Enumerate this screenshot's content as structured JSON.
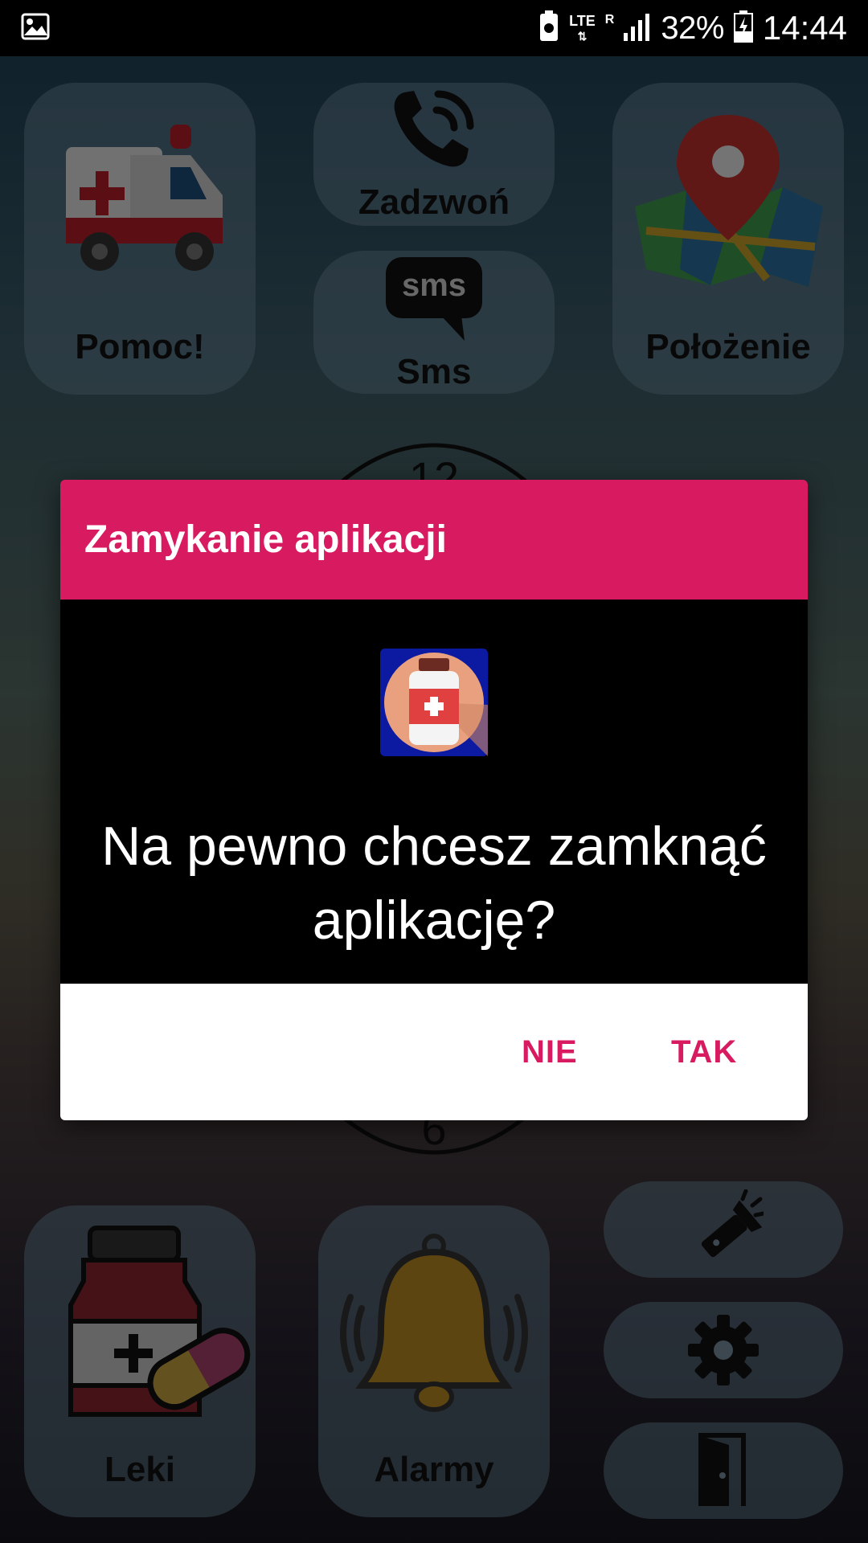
{
  "status_bar": {
    "network": "LTE",
    "roaming": "R",
    "battery": "32%",
    "time": "14:44"
  },
  "tiles": {
    "help": "Pomoc!",
    "call": "Zadzwoń",
    "sms": "Sms",
    "location": "Położenie",
    "meds": "Leki",
    "alarms": "Alarmy"
  },
  "clock": {
    "top": "12",
    "bottom": "6"
  },
  "dialog": {
    "title": "Zamykanie aplikacji",
    "message": "Na pewno chcesz zamknąć aplikację?",
    "no_label": "NIE",
    "yes_label": "TAK"
  },
  "colors": {
    "accent": "#d81b60",
    "tile": "#6e8ca0",
    "dialog_body": "#000000"
  },
  "icons": [
    "image-icon",
    "recycle-icon",
    "signal-icon",
    "battery-icon",
    "ambulance-icon",
    "phone-icon",
    "sms-icon",
    "map-pin-icon",
    "medicine-icon",
    "bell-icon",
    "flashlight-icon",
    "gear-icon",
    "exit-door-icon",
    "app-medicine-icon"
  ]
}
